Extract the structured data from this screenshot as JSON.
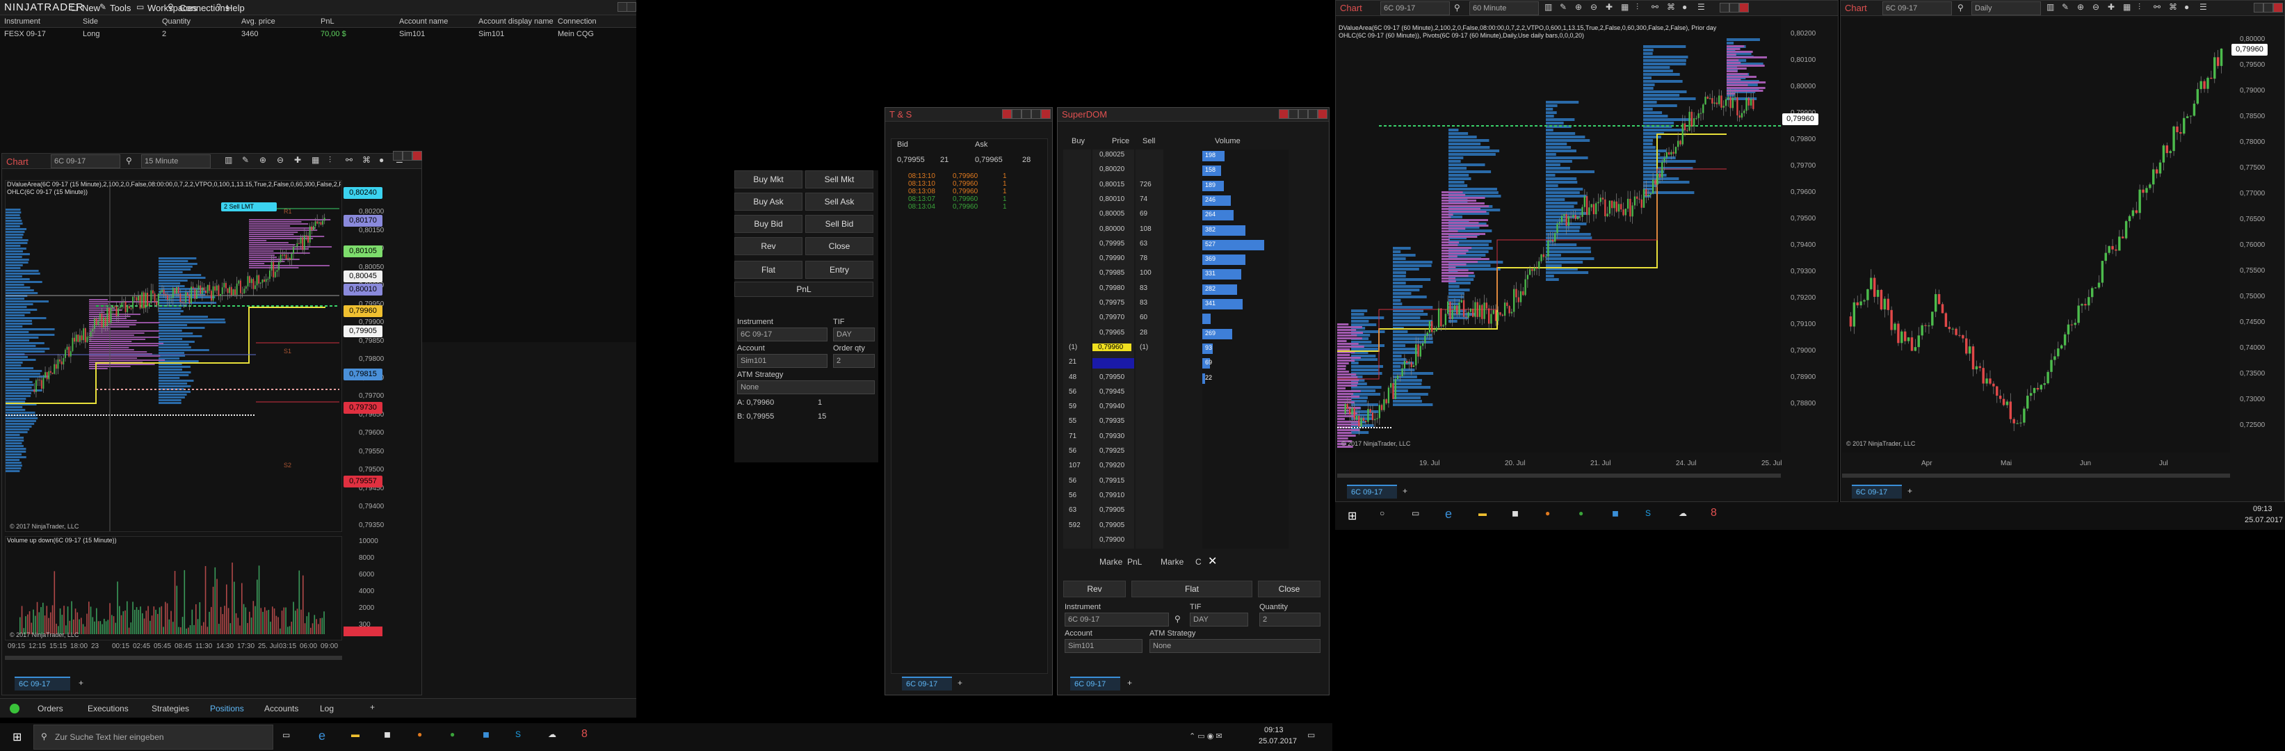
{
  "menu": {
    "logo": "NINJATRADER",
    "items": [
      "New",
      "Tools",
      "Workspaces",
      "Connections",
      "Help"
    ]
  },
  "positions": {
    "columns": [
      "Instrument",
      "Side",
      "Quantity",
      "Avg. price",
      "PnL",
      "Account name",
      "Account display name",
      "Connection"
    ],
    "rows": [
      [
        "FESX 09-17",
        "Long",
        "2",
        "3460",
        "70,00 $",
        "Sim101",
        "Sim101",
        "Mein CQG"
      ]
    ]
  },
  "chart1": {
    "title": "Chart",
    "instrument": "6C 09-17",
    "interval": "15 Minute",
    "indicator_line1": "DValueArea(6C 09-17 (15 Minute),2,100,2,0,False,08:00:00,0,7,2,2,VTPO,0,100,1,13.15,True,2,False,0,60,300,False,2,False), Pivots(6C 09-17 (15 Minute),Daily,Use daily bars,0,0,0,20), Prior day",
    "indicator_line2": "OHLC(6C 09-17 (15 Minute))",
    "copyright": "© 2017 NinjaTrader, LLC",
    "volume_title": "Volume up down(6C 09-17 (15 Minute))",
    "sell_lmt": "2  Sell LMT",
    "price_ticks": [
      "0,80200",
      "0,80150",
      "0,80100",
      "0,80050",
      "0,80000",
      "0,79950",
      "0,79900",
      "0,79850",
      "0,79800",
      "0,79750",
      "0,79700",
      "0,79650",
      "0,79600",
      "0,79550",
      "0,79500",
      "0,79450",
      "0,79400",
      "0,79350"
    ],
    "price_tags": [
      {
        "label": "0,80240",
        "color": "#3bd3f0"
      },
      {
        "label": "0,80170",
        "color": "#8a8adc"
      },
      {
        "label": "0,80105",
        "color": "#7ddc6c"
      },
      {
        "label": "0,80045",
        "color": "#f0f0f0"
      },
      {
        "label": "0,80010",
        "color": "#8a8adc"
      },
      {
        "label": "0,79960",
        "color": "#f0c030"
      },
      {
        "label": "0,79905",
        "color": "#f4f4f4"
      },
      {
        "label": "0,79815",
        "color": "#4a90d9"
      },
      {
        "label": "0,79730",
        "color": "#e03040"
      },
      {
        "label": "0,79557",
        "color": "#e03040"
      }
    ],
    "volume_ticks": [
      "10000",
      "8000",
      "6000",
      "4000",
      "2000",
      "300"
    ],
    "time_ticks": [
      "09:15",
      "12:15",
      "15:15",
      "18:00",
      "23",
      "00:15",
      "02:45",
      "05:45",
      "08:45",
      "11:30",
      "14:30",
      "17:30",
      "25. Jul",
      "03:15",
      "06:00",
      "09:00"
    ],
    "pivot_labels": [
      "R1",
      "S1",
      "S2"
    ],
    "tab": "6C 09-17"
  },
  "chart_trader": {
    "buttons": [
      "Buy Mkt",
      "Sell Mkt",
      "Buy Ask",
      "Sell Ask",
      "Buy Bid",
      "Sell Bid",
      "Rev",
      "Close",
      "Flat",
      "Entry",
      "PnL"
    ],
    "instrument_label": "Instrument",
    "instrument_value": "6C 09-17",
    "tif_label": "TIF",
    "tif_value": "DAY",
    "account_label": "Account",
    "account_value": "Sim101",
    "order_qty_label": "Order qty",
    "order_qty_value": "2",
    "atm_label": "ATM Strategy",
    "atm_value": "None",
    "ask_line": "A:  0,79960",
    "ask_qty": "1",
    "bid_line": "B:  0,79955",
    "bid_qty": "15"
  },
  "ts": {
    "title": "T & S",
    "bid_header": "Bid",
    "ask_header": "Ask",
    "bid_value": "0,79955",
    "bid_size": "21",
    "ask_value": "0,79965",
    "ask_size": "28",
    "trades": [
      {
        "time": "08:13:10",
        "price": "0,79960",
        "size": "1",
        "color": "#e07a1f"
      },
      {
        "time": "08:13:10",
        "price": "0,79960",
        "size": "1",
        "color": "#e07a1f"
      },
      {
        "time": "08:13:08",
        "price": "0,79960",
        "size": "1",
        "color": "#e07a1f"
      },
      {
        "time": "08:13:07",
        "price": "0,79960",
        "size": "1",
        "color": "#3aa43a"
      },
      {
        "time": "08:13:04",
        "price": "0,79960",
        "size": "1",
        "color": "#3aa43a"
      }
    ],
    "tab": "6C 09-17"
  },
  "superdom": {
    "title": "SuperDOM",
    "headers": [
      "Buy",
      "Price",
      "Sell",
      "Volume"
    ],
    "rows": [
      {
        "buy": "",
        "price": "0,80025",
        "sell": "",
        "vol": "198",
        "volw": 0.26
      },
      {
        "buy": "",
        "price": "0,80020",
        "sell": "",
        "vol": "158",
        "volw": 0.22
      },
      {
        "buy": "",
        "price": "0,80015",
        "sell": "726",
        "vol": "189",
        "volw": 0.25
      },
      {
        "buy": "",
        "price": "0,80010",
        "sell": "74",
        "vol": "246",
        "volw": 0.33
      },
      {
        "buy": "",
        "price": "0,80005",
        "sell": "69",
        "vol": "264",
        "volw": 0.36
      },
      {
        "buy": "",
        "price": "0,80000",
        "sell": "108",
        "vol": "382",
        "volw": 0.5
      },
      {
        "buy": "",
        "price": "0,79995",
        "sell": "63",
        "vol": "527",
        "volw": 0.72
      },
      {
        "buy": "",
        "price": "0,79990",
        "sell": "78",
        "vol": "369",
        "volw": 0.5
      },
      {
        "buy": "",
        "price": "0,79985",
        "sell": "100",
        "vol": "331",
        "volw": 0.45
      },
      {
        "buy": "",
        "price": "0,79980",
        "sell": "83",
        "vol": "282",
        "volw": 0.4
      },
      {
        "buy": "",
        "price": "0,79975",
        "sell": "83",
        "vol": "341",
        "volw": 0.47
      },
      {
        "buy": "",
        "price": "0,79970",
        "sell": "60",
        "vol": "",
        "volw": 0.1
      },
      {
        "buy": "",
        "price": "0,79965",
        "sell": "28",
        "vol": "269",
        "volw": 0.35
      },
      {
        "buy": "(1)",
        "price": "0,79960",
        "sell": "(1)",
        "vol": "93",
        "volw": 0.12
      },
      {
        "buy": "21",
        "price": "",
        "sell": "",
        "vol": "69",
        "volw": 0.09
      },
      {
        "buy": "48",
        "price": "0,79950",
        "sell": "",
        "vol": "22",
        "volw": 0.03
      },
      {
        "buy": "56",
        "price": "0,79945",
        "sell": "",
        "vol": "",
        "volw": 0
      },
      {
        "buy": "59",
        "price": "0,79940",
        "sell": "",
        "vol": "",
        "volw": 0
      },
      {
        "buy": "55",
        "price": "0,79935",
        "sell": "",
        "vol": "",
        "volw": 0
      },
      {
        "buy": "71",
        "price": "0,79930",
        "sell": "",
        "vol": "",
        "volw": 0
      },
      {
        "buy": "56",
        "price": "0,79925",
        "sell": "",
        "vol": "",
        "volw": 0
      },
      {
        "buy": "107",
        "price": "0,79920",
        "sell": "",
        "vol": "",
        "volw": 0
      },
      {
        "buy": "56",
        "price": "0,79915",
        "sell": "",
        "vol": "",
        "volw": 0
      },
      {
        "buy": "56",
        "price": "0,79910",
        "sell": "",
        "vol": "",
        "volw": 0
      },
      {
        "buy": "63",
        "price": "0,79905",
        "sell": "",
        "vol": "",
        "volw": 0
      },
      {
        "buy": "592",
        "price": "0,79905",
        "sell": "",
        "vol": "",
        "volw": 0
      },
      {
        "buy": "",
        "price": "0,79900",
        "sell": "",
        "vol": "",
        "volw": 0
      }
    ],
    "bottom_labels": [
      "Marke",
      "PnL",
      "Marke",
      "C"
    ],
    "rev": "Rev",
    "flat": "Flat",
    "close": "Close",
    "instrument_label": "Instrument",
    "instrument_value": "6C 09-17",
    "tif_label": "TIF",
    "tif_value": "DAY",
    "qty_label": "Quantity",
    "qty_value": "2",
    "account_label": "Account",
    "account_value": "Sim101",
    "atm_label": "ATM Strategy",
    "atm_value": "None",
    "tab": "6C 09-17"
  },
  "chart2": {
    "title": "Chart",
    "instrument": "6C 09-17",
    "interval": "60 Minute",
    "indicator_line1": "DValueArea(6C 09-17 (60 Minute),2,100,2,0,False,08:00:00,0,7,2,2,VTPO,0,600,1,13.15,True,2,False,0,60,300,False,2,False), Prior day",
    "indicator_line2": "OHLC(6C 09-17 (60 Minute)), Pivots(6C 09-17 (60 Minute),Daily,Use daily bars,0,0,0,20)",
    "copyright": "© 2017 NinjaTrader, LLC",
    "price_ticks": [
      "0,80200",
      "0,80100",
      "0,80000",
      "0,79900",
      "0,79800",
      "0,79700",
      "0,79600",
      "0,79500",
      "0,79400",
      "0,79300",
      "0,79200",
      "0,79100",
      "0,79000",
      "0,78900",
      "0,78800"
    ],
    "current_price": "0,79960",
    "time_ticks": [
      "19. Jul",
      "20. Jul",
      "21. Jul",
      "24. Jul",
      "25. Jul"
    ],
    "pivot_labels": [
      "R1",
      "S1",
      "S2",
      "S3"
    ],
    "tab": "6C 09-17"
  },
  "chart3": {
    "title": "Chart",
    "instrument": "6C 09-17",
    "interval": "Daily",
    "copyright": "© 2017 NinjaTrader, LLC",
    "price_ticks": [
      "0,80000",
      "0,79500",
      "0,79000",
      "0,78500",
      "0,78000",
      "0,77500",
      "0,77000",
      "0,76500",
      "0,76000",
      "0,75500",
      "0,75000",
      "0,74500",
      "0,74000",
      "0,73500",
      "0,73000",
      "0,72500"
    ],
    "current_price": "0,79960",
    "time_ticks": [
      "Apr",
      "Mai",
      "Jun",
      "Jul"
    ],
    "tab": "6C 09-17"
  },
  "control_tabs": [
    "Orders",
    "Executions",
    "Strategies",
    "Positions",
    "Accounts",
    "Log"
  ],
  "taskbar": {
    "search_placeholder": "Zur Suche Text hier eingeben",
    "time": "09:13",
    "date": "25.07.2017"
  },
  "taskbar2": {
    "time": "09:13",
    "date": "25.07.2017"
  }
}
